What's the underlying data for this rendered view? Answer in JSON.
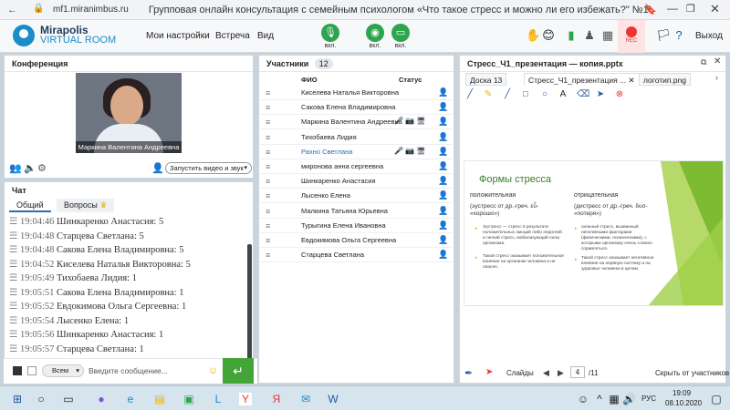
{
  "browser": {
    "url": "mf1.miranimbus.ru",
    "title": "Групповая онлайн консультация с семейным психологом «Что такое стресс и можно ли его избежать?\" №1"
  },
  "header": {
    "logo_line1": "Mirapolis",
    "logo_line2": "VIRTUAL ROOM",
    "menu": [
      "Мои настройки",
      "Встреча",
      "Вид"
    ],
    "controls": [
      {
        "icon": "microphone-icon",
        "label": "вкл."
      },
      {
        "icon": "camera-icon",
        "label": "вкл."
      },
      {
        "icon": "screen-share-icon",
        "label": "вкл."
      }
    ],
    "rec_label": "REC",
    "exit_label": "Выход",
    "accent_color": "#2ea44f"
  },
  "conference": {
    "title": "Конференция",
    "video_caption": "Маркина Валентина Андреевна",
    "start_video_label": "Запустить видео и звук"
  },
  "chat": {
    "title": "Чат",
    "tabs": [
      "Общий",
      "Вопросы"
    ],
    "messages": [
      {
        "time": "19:04:46",
        "text": "Шинкаренко Анастасия: 5"
      },
      {
        "time": "19:04:48",
        "text": "Старцева Светлана: 5"
      },
      {
        "time": "19:04:48",
        "text": "Сакова Елена Владимировна: 5"
      },
      {
        "time": "19:04:52",
        "text": "Киселева Наталья Викторовна: 5"
      },
      {
        "time": "19:05:49",
        "text": "Тихобаева Лидия: 1"
      },
      {
        "time": "19:05:51",
        "text": "Сакова Елена Владимировна: 1"
      },
      {
        "time": "19:05:52",
        "text": "Евдокимова Ольга Сергеевна: 1"
      },
      {
        "time": "19:05:54",
        "text": "Лысенко Елена: 1"
      },
      {
        "time": "19:05:56",
        "text": "Шинкаренко Анастасия: 1"
      },
      {
        "time": "19:05:57",
        "text": "Старцева Светлана: 1"
      }
    ],
    "recipient": "Всем",
    "input_placeholder": "Введите сообщение..."
  },
  "participants": {
    "title": "Участники",
    "count": "12",
    "col_name": "ФИО",
    "col_status": "Статус",
    "rows": [
      {
        "name": "Киселева Наталья Викторовна",
        "status": ""
      },
      {
        "name": "Сакова Елена Владимировна",
        "status": ""
      },
      {
        "name": "Маркина Валентина Андреевна",
        "status": "🎤 📷 🖥"
      },
      {
        "name": "Тихобаева Лидия",
        "status": ""
      },
      {
        "name": "Рахно Светлана",
        "status": "🎤 📷 🖥"
      },
      {
        "name": "миронова анна сергеевна",
        "status": ""
      },
      {
        "name": "Шинкаренко Анастасия",
        "status": ""
      },
      {
        "name": "Лысенко Елена",
        "status": ""
      },
      {
        "name": "Малкина Татьяна Юрьевна",
        "status": ""
      },
      {
        "name": "Турыгина Елена Ивановна",
        "status": ""
      },
      {
        "name": "Евдокимова Ольга Сергеевна",
        "status": ""
      },
      {
        "name": "Старцева Светлана",
        "status": ""
      }
    ]
  },
  "presentation": {
    "file_title": "Стресс_Ч1_презентация — копия.pptx",
    "tabs": [
      "Доска 13",
      "Стресс_Ч1_презентация ...",
      "логотип.png"
    ],
    "slide_title": "Формы стресса",
    "left_heading": "положительная",
    "left_sub": "(эустресс от др.-греч. εὖ- «хорошо»)",
    "left_bullets": [
      "Эустресс — стресс в результате положительных эмоций либо недолгий и легкий стресс, мобилизующий силы организма.",
      "Такой стресс оказывает положительное влияние на организм человека и не опасен."
    ],
    "right_heading": "отрицательная",
    "right_sub": "(дистресс от др.-греч. δυσ- «потеря»)",
    "right_bullets": [
      "сильный стресс, вызванный негативными факторами (физическими, психическими), с которыми организму очень сложно справляться.",
      "Такой стресс оказывает негативное влияние на нервную систему и на здоровье человека в целом."
    ],
    "slides_label": "Слайды",
    "current_page": "4",
    "total_pages": "/11",
    "hide_label": "Скрыть от участников"
  },
  "taskbar": {
    "lang": "РУС",
    "time": "19:09",
    "date": "08.10.2020"
  }
}
